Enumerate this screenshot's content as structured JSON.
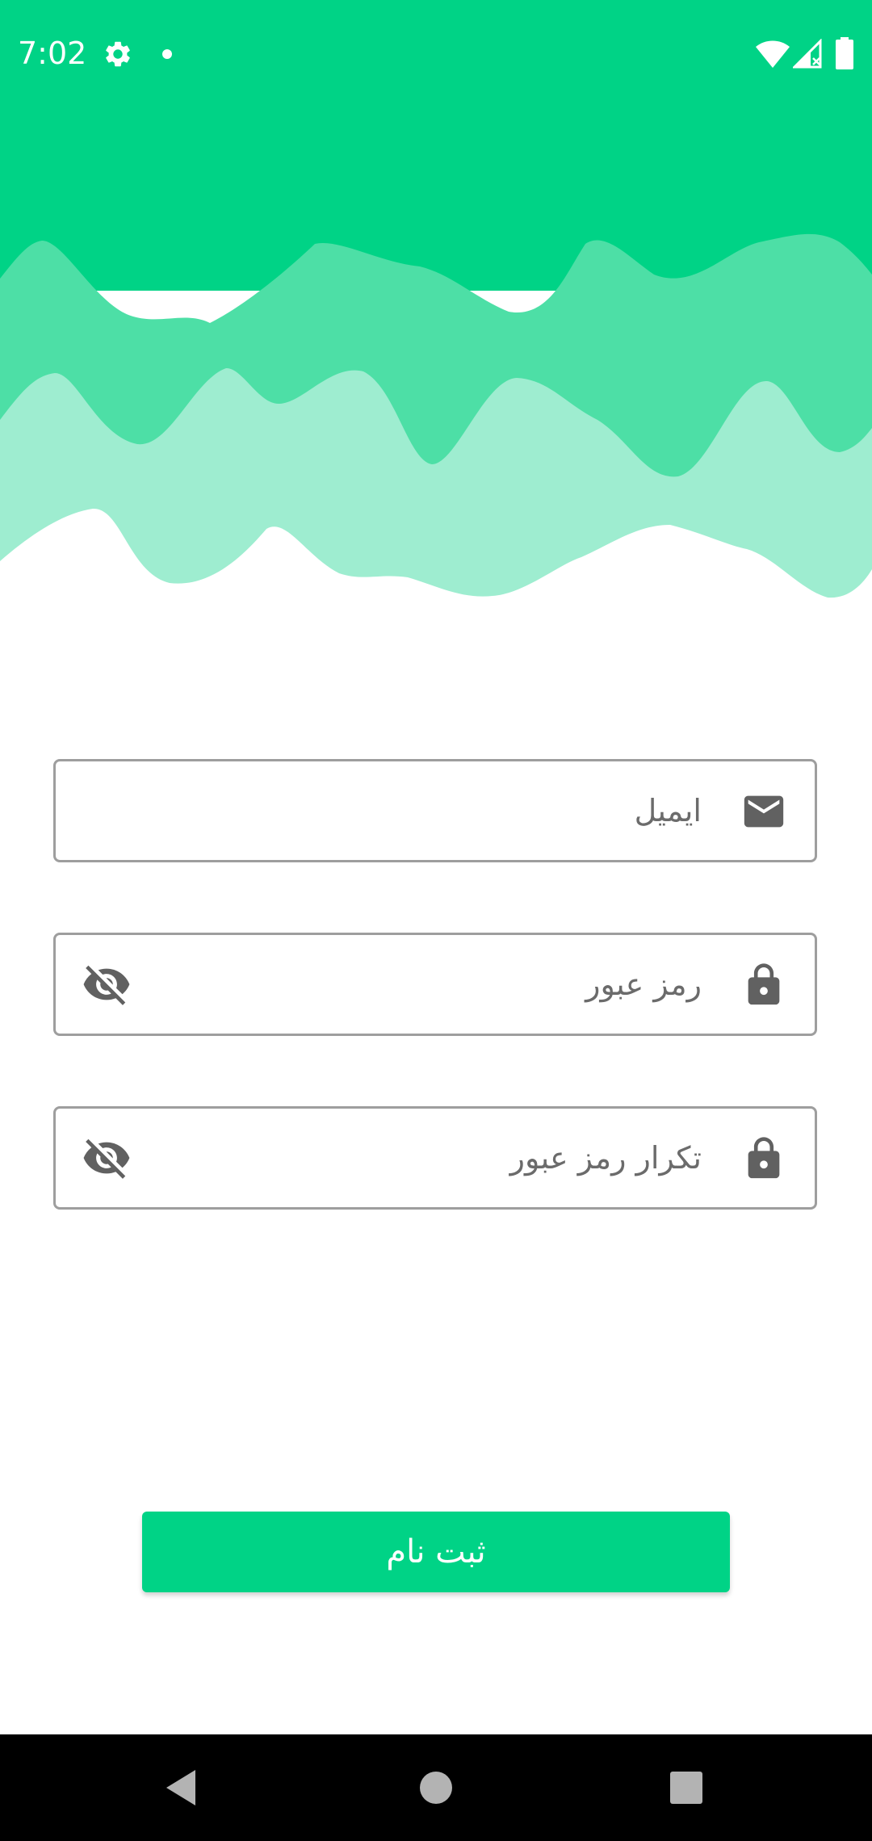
{
  "status_bar": {
    "time": "7:02",
    "icons": [
      "settings-icon",
      "notification-dot-icon",
      "wifi-icon",
      "cellular-signal-icon",
      "battery-icon"
    ]
  },
  "colors": {
    "accent": "#00d386",
    "wave_mid": "#4ddfa6",
    "wave_light": "#9eedd0",
    "icon_gray": "#616161",
    "border_gray": "#9e9e9e"
  },
  "form": {
    "email": {
      "placeholder": "ایمیل",
      "icon": "email-icon"
    },
    "password": {
      "placeholder": "رمز عبور",
      "icon": "lock-icon",
      "toggle_icon": "visibility-off-icon"
    },
    "confirm_password": {
      "placeholder": "تکرار رمز عبور",
      "icon": "lock-icon",
      "toggle_icon": "visibility-off-icon"
    }
  },
  "submit": {
    "label": "ثبت نام"
  },
  "nav_bar": {
    "buttons": [
      "back-icon",
      "home-icon",
      "recents-icon"
    ]
  }
}
